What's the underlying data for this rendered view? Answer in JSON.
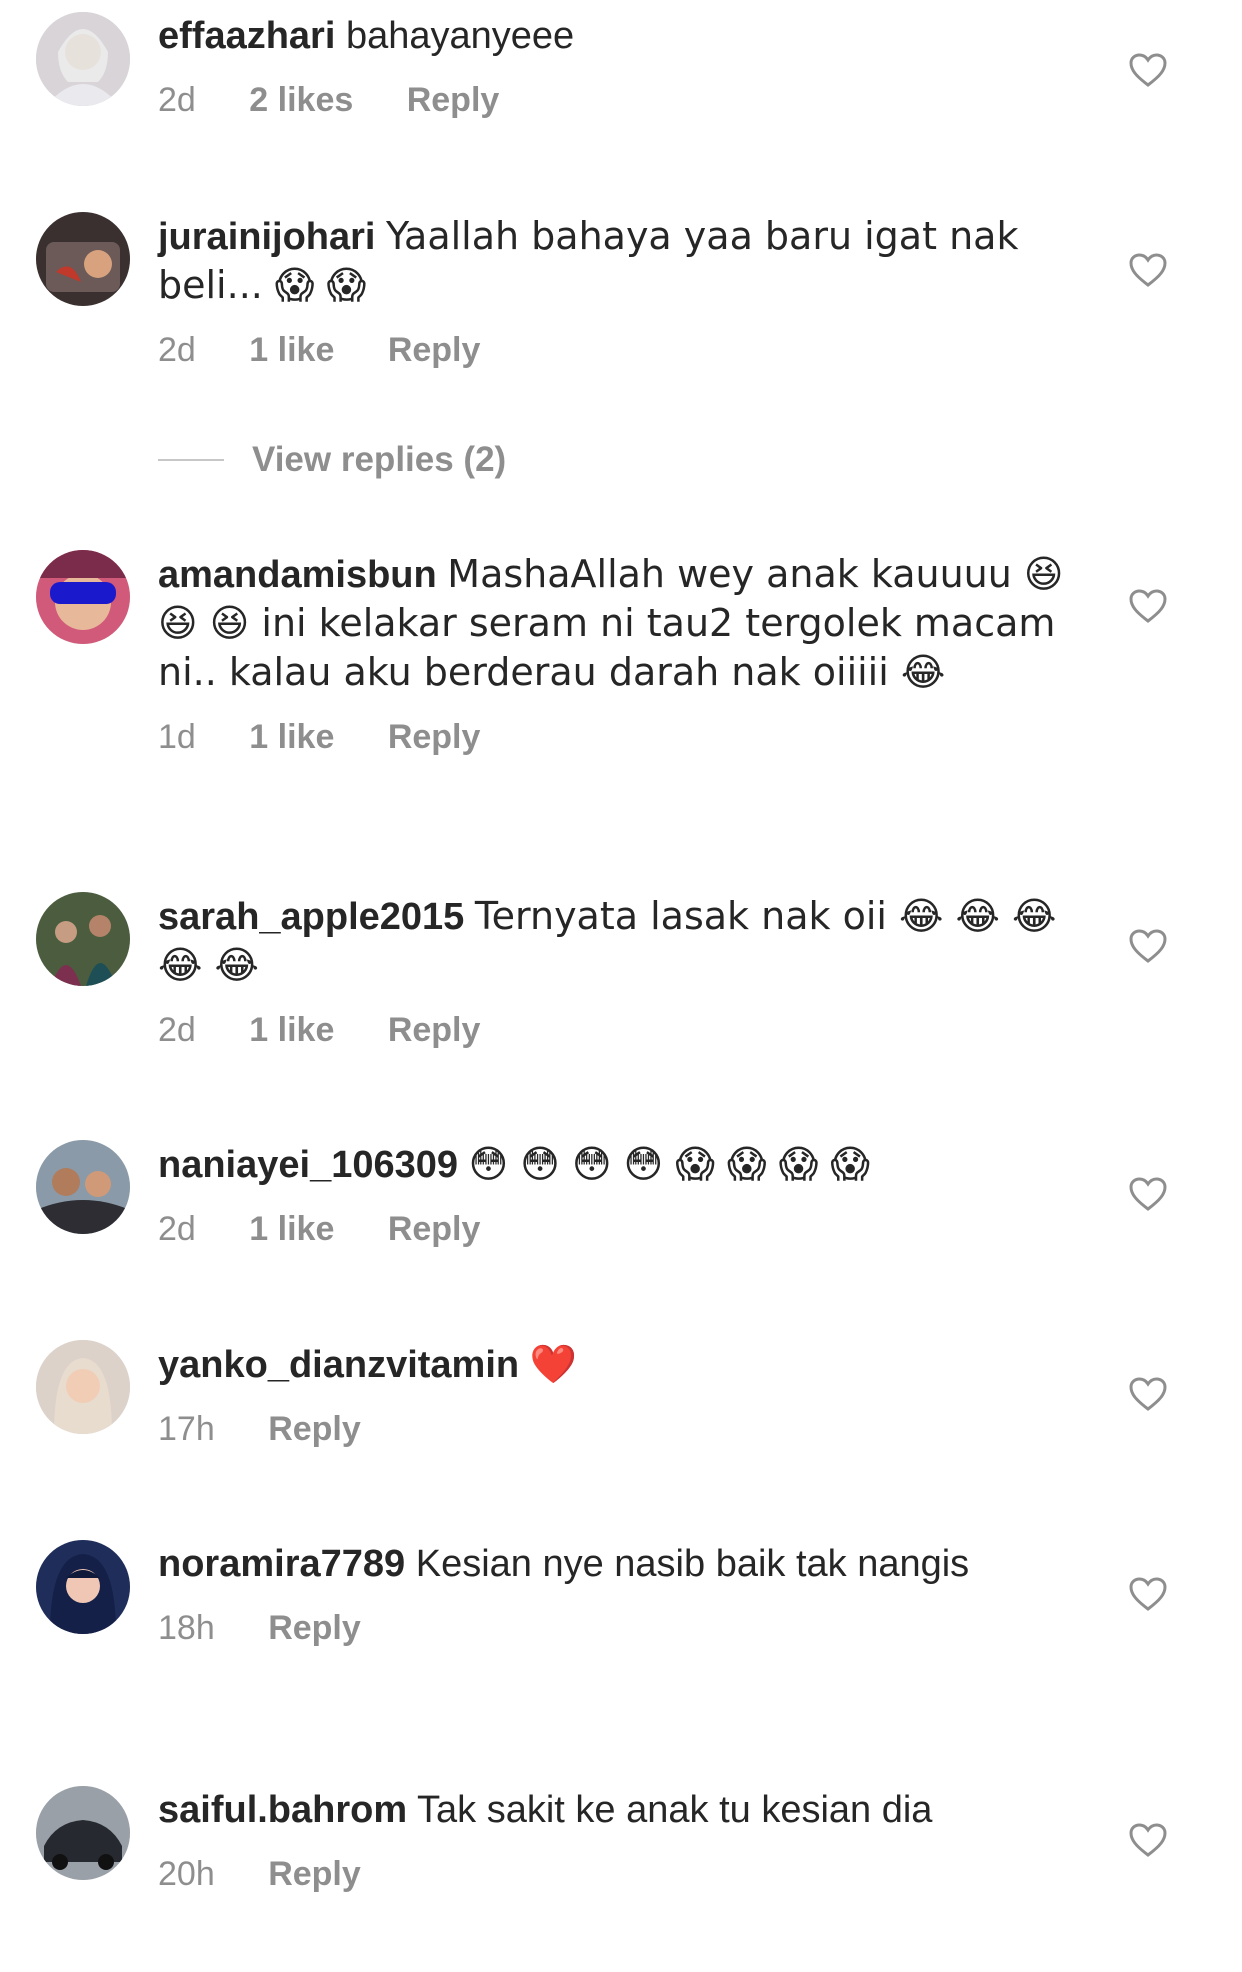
{
  "comments": [
    {
      "username": "effaazhari",
      "text": "bahayanyeee",
      "time": "2d",
      "likes": "2 likes",
      "reply": "Reply"
    },
    {
      "username": "jurainijohari",
      "text": "Yaallah bahaya yaa baru igat nak beli... 😱 😱",
      "time": "2d",
      "likes": "1 like",
      "reply": "Reply"
    },
    {
      "username": "amandamisbun",
      "text": "MashaAllah wey anak kauuuu 😆 😆 😆 ini kelakar seram ni tau2 tergolek macam ni.. kalau aku berderau darah nak oiiiii 😂",
      "time": "1d",
      "likes": "1 like",
      "reply": "Reply"
    },
    {
      "username": "sarah_apple2015",
      "text": "Ternyata lasak nak oii 😂 😂 😂 😂 😂",
      "time": "2d",
      "likes": "1 like",
      "reply": "Reply"
    },
    {
      "username": "naniayei_106309",
      "text": "😳 😳 😳 😳 😱 😱 😱 😱",
      "time": "2d",
      "likes": "1 like",
      "reply": "Reply"
    },
    {
      "username": "yanko_dianzvitamin",
      "text": "❤️",
      "time": "17h",
      "reply": "Reply"
    },
    {
      "username": "noramira7789",
      "text": "Kesian nye nasib baik tak nangis",
      "time": "18h",
      "reply": "Reply"
    },
    {
      "username": "saiful.bahrom",
      "text": "Tak sakit ke anak tu kesian dia",
      "time": "20h",
      "reply": "Reply"
    }
  ],
  "view_replies": "View replies (2)",
  "icons": {
    "like": "heart-outline-icon"
  },
  "colors": {
    "text": "#262626",
    "meta": "#8e8e8e",
    "heart_stroke": "#8e8e8e"
  }
}
